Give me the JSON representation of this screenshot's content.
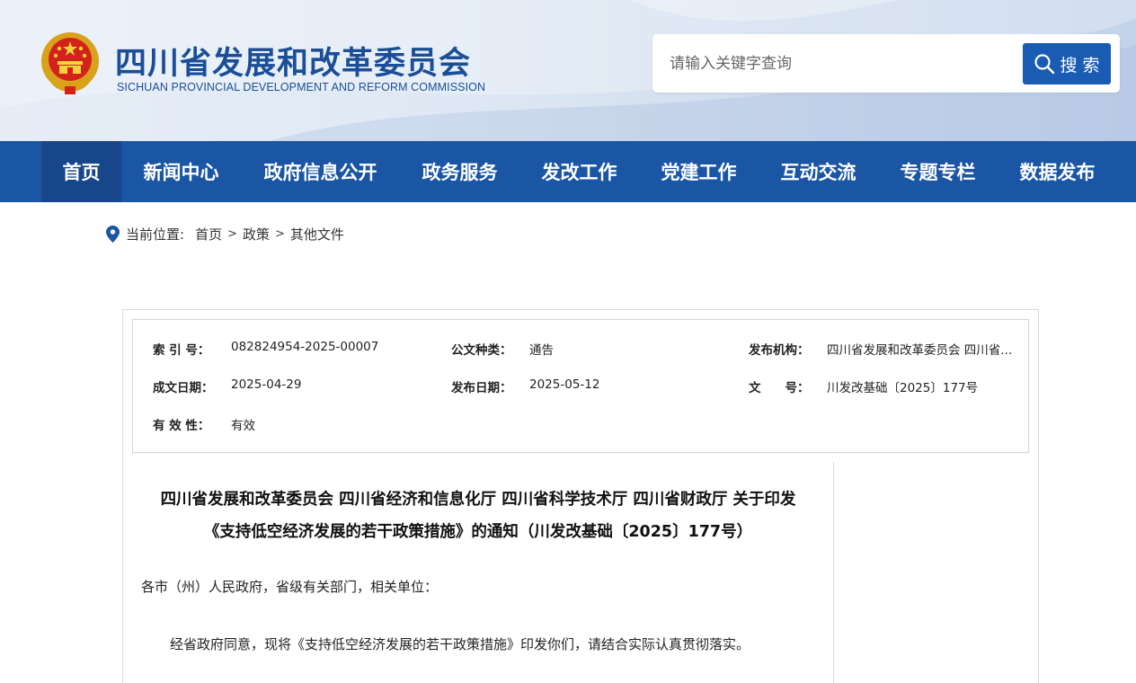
{
  "header": {
    "title": "四川省发展和改革委员会",
    "subtitle": "SICHUAN PROVINCIAL DEVELOPMENT AND REFORM COMMISSION",
    "search_placeholder": "请输入关键字查询",
    "search_button": "搜 索",
    "emblem_icon": "national-emblem-icon"
  },
  "nav": {
    "items": [
      {
        "label": "首页",
        "active": true
      },
      {
        "label": "新闻中心"
      },
      {
        "label": "政府信息公开"
      },
      {
        "label": "政务服务"
      },
      {
        "label": "发改工作"
      },
      {
        "label": "党建工作"
      },
      {
        "label": "互动交流"
      },
      {
        "label": "专题专栏"
      },
      {
        "label": "数据发布"
      }
    ]
  },
  "breadcrumb": {
    "prefix": "当前位置:",
    "items": [
      "首页",
      "政策",
      "其他文件"
    ],
    "separator": ">"
  },
  "meta": {
    "index_label": "索 引 号：",
    "index_value": "082824954-2025-00007",
    "type_label": "公文种类：",
    "type_value": "通告",
    "org_label": "发布机构：",
    "org_value": "四川省发展和改革委员会 四川省...",
    "created_label": "成文日期：",
    "created_value": "2025-04-29",
    "published_label": "发布日期：",
    "published_value": "2025-05-12",
    "docno_label": "文　　号：",
    "docno_value": "川发改基础〔2025〕177号",
    "validity_label": "有 效 性：",
    "validity_value": "有效"
  },
  "document": {
    "title_line1": "四川省发展和改革委员会 四川省经济和信息化厅 四川省科学技术厅 四川省财政厅 关于印发",
    "title_line2": "《支持低空经济发展的若干政策措施》的通知（川发改基础〔2025〕177号）",
    "salutation": "各市（州）人民政府，省级有关部门，相关单位：",
    "paragraph1": "经省政府同意，现将《支持低空经济发展的若干政策措施》印发你们，请结合实际认真贯彻落实。"
  },
  "colors": {
    "brand_blue": "#1a4e96",
    "nav_blue": "#1b56a4",
    "nav_active": "#17478a",
    "search_button": "#1a5bb4"
  }
}
